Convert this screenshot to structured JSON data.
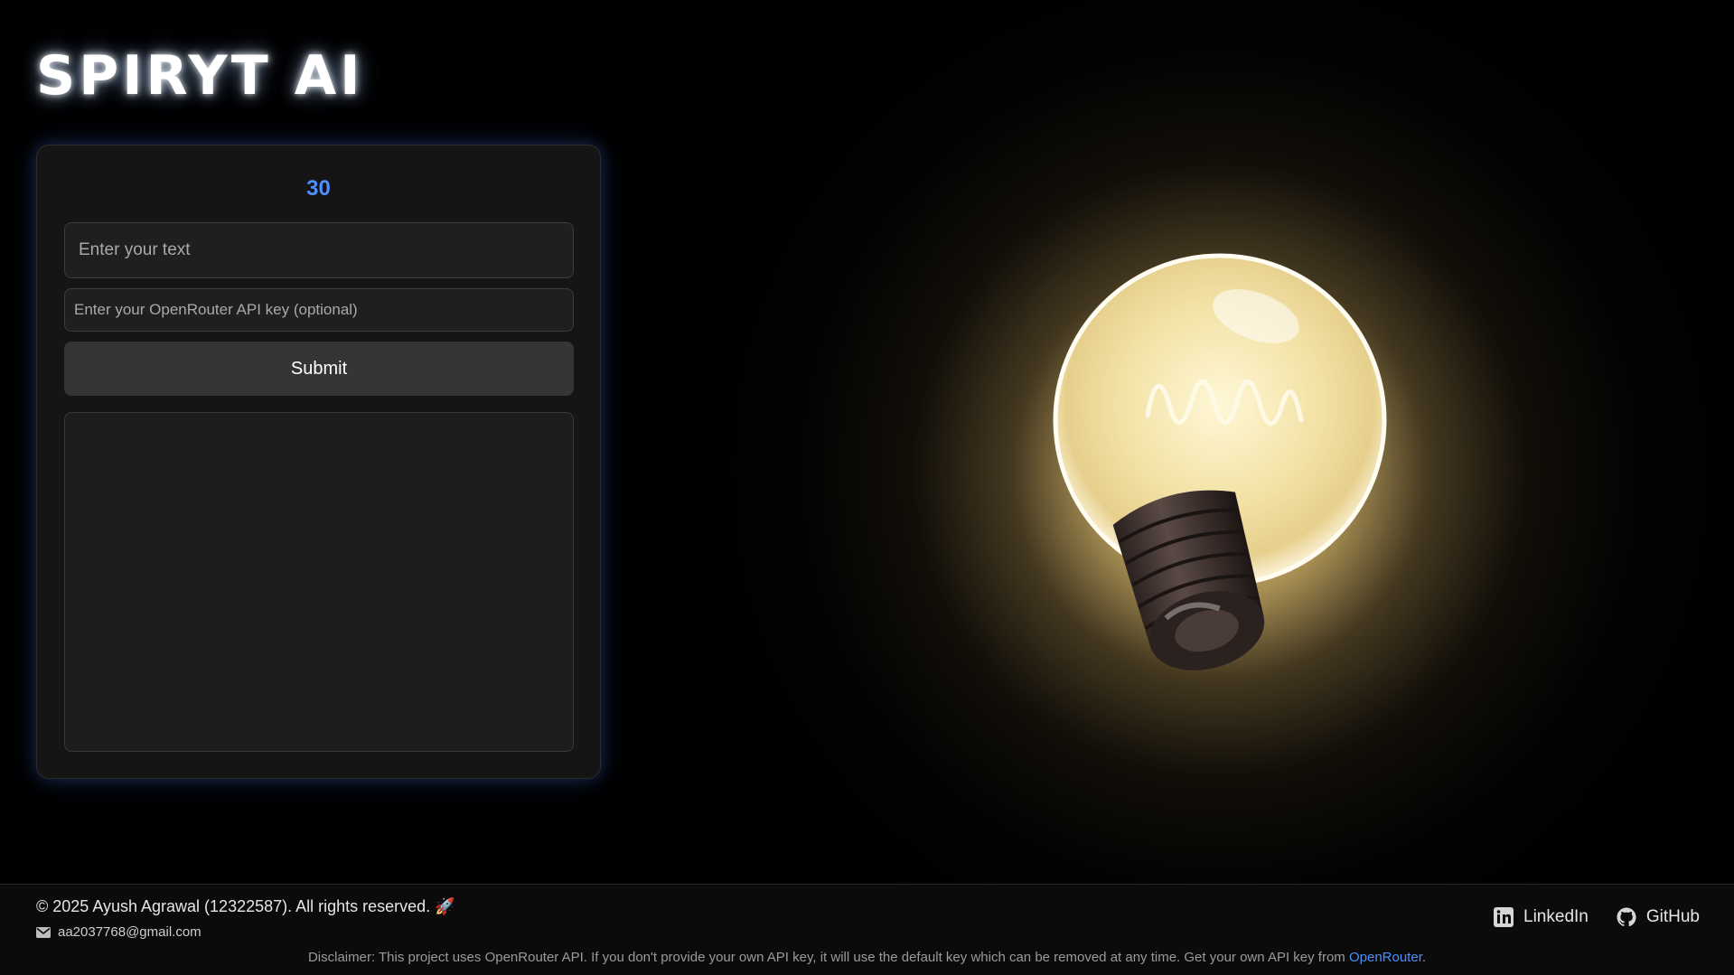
{
  "brand": {
    "title": "SPIRYT AI"
  },
  "form": {
    "counter": "30",
    "text_placeholder": "Enter your text",
    "api_placeholder": "Enter your OpenRouter API key (optional)",
    "submit_label": "Submit",
    "output_text": ""
  },
  "footer": {
    "copyright": "© 2025 Ayush Agrawal (12322587). All rights reserved. 🚀",
    "email": "aa2037768@gmail.com",
    "links": [
      {
        "label": "LinkedIn",
        "icon": "linkedin-icon"
      },
      {
        "label": "GitHub",
        "icon": "github-icon"
      }
    ],
    "disclaimer_text": "Disclaimer: This project uses OpenRouter API. If you don't provide your own API key, it will use the default key which can be removed at any time. Get your own API key from ",
    "disclaimer_link": "OpenRouter",
    "disclaimer_end": "."
  },
  "colors": {
    "accent": "#4d8fff",
    "background": "#000000",
    "card": "#151515",
    "button": "#353535"
  }
}
